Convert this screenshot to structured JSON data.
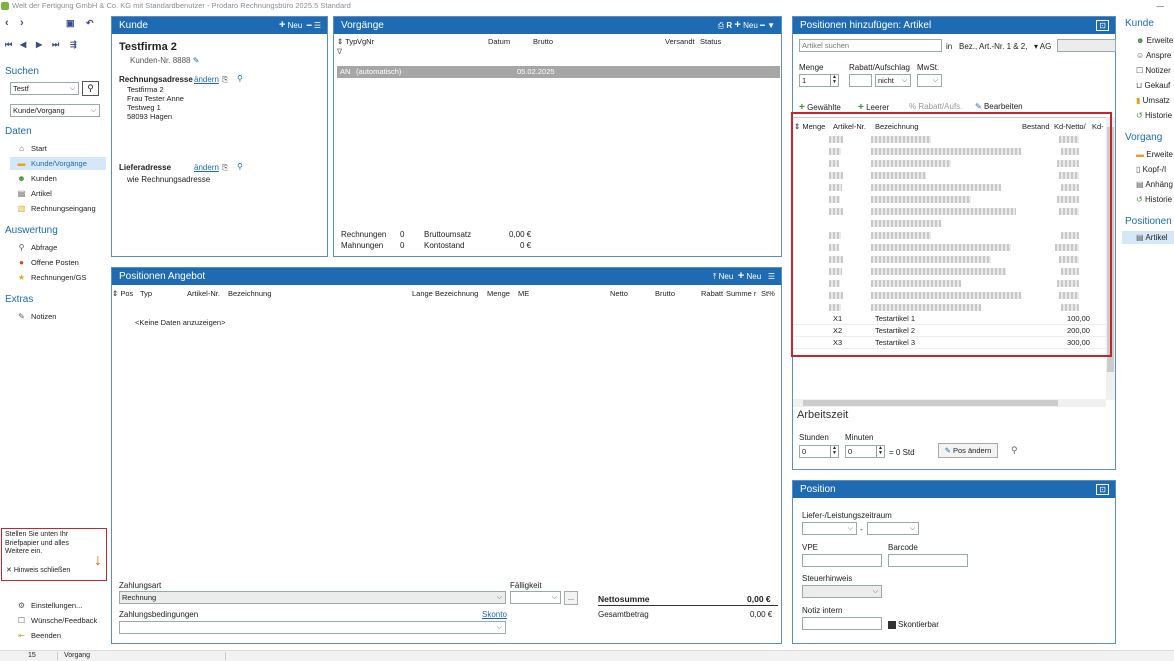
{
  "titlebar": {
    "title": "Welt der Fertigung GmbH & Co. KG mit Standardbenutzer - Prodaro Rechnungsbüro 2025.5 Standard",
    "min": "—"
  },
  "nav": {
    "search_section": "Suchen",
    "search_value": "Testf",
    "search_scope": "Kunde/Vorgang",
    "daten": "Daten",
    "daten_items": [
      "Start",
      "Kunde/Vorgänge",
      "Kunden",
      "Artikel",
      "Rechnungseingang"
    ],
    "auswertung": "Auswertung",
    "auswertung_items": [
      "Abfrage",
      "Offene Posten",
      "Rechnungen/GS"
    ],
    "extras": "Extras",
    "extras_items": [
      "Notizen"
    ],
    "bottom_items": [
      "Einstellungen...",
      "Wünsche/Feedback",
      "Beenden"
    ]
  },
  "hint": {
    "text": "Stellen Sie unten Ihr Briefpapier und alles Weitere ein.",
    "close": "Hinweis schließen"
  },
  "kunde": {
    "header": "Kunde",
    "neu": "Neu",
    "name": "Testfirma 2",
    "kundennr": "Kunden-Nr. 8888",
    "rechnungsadresse": "Rechnungsadresse",
    "aendern": "ändern",
    "address": [
      "Testfirma 2",
      "Frau Tester Anne",
      "Testweg 1",
      "58093 Hagen"
    ],
    "lieferadresse": "Lieferadresse",
    "liefer_value": "wie Rechnungsadresse"
  },
  "vorgaenge": {
    "header": "Vorgänge",
    "r": "R",
    "neu": "Neu",
    "cols": [
      "Typ",
      "VgNr",
      "Datum",
      "Brutto",
      "Versandt",
      "Status"
    ],
    "row": {
      "typ": "AN",
      "vgnr": "(automatisch)",
      "datum": "05.02.2025"
    },
    "summary": {
      "rechnungen": "Rechnungen",
      "rechnungen_val": "0",
      "mahnungen": "Mahnungen",
      "mahnungen_val": "0",
      "bruttoumsatz": "Bruttoumsatz",
      "bruttoumsatz_val": "0,00 €",
      "kontostand": "Kontostand",
      "kontostand_val": "0 €"
    }
  },
  "positionen_angebot": {
    "header": "Positionen Angebot",
    "neu1": "Neu",
    "neu2": "Neu",
    "cols": [
      "Pos",
      "Typ",
      "Artikel-Nr.",
      "Bezeichnung",
      "Lange Bezeichnung",
      "Menge",
      "ME",
      "Netto",
      "Brutto",
      "Rabatt",
      "Summe r",
      "St%"
    ],
    "empty": "<Keine Daten anzuzeigen>",
    "zahlungsart_label": "Zahlungsart",
    "zahlungsart_value": "Rechnung",
    "faelligkeit": "Fälligkeit",
    "zahlungsbedingungen": "Zahlungsbedingungen",
    "skonto": "Skonto",
    "nettosumme": "Nettosumme",
    "nettosumme_val": "0,00 €",
    "gesamtbetrag": "Gesamtbetrag",
    "gesamtbetrag_val": "0,00 €"
  },
  "artikel_panel": {
    "header": "Positionen hinzufügen: Artikel",
    "search_placeholder": "Artikel suchen",
    "in": "in",
    "scope": "Bez., Art.-Nr. 1 & 2,",
    "ag": "AG",
    "menge": "Menge",
    "rabatt": "Rabatt/Aufschlag",
    "mwst": "MwSt.",
    "menge_val": "1",
    "nicht": "nicht",
    "btn_gewaehlte": "Gewählte",
    "btn_leerer": "Leerer",
    "btn_rabatt": "Rabatt/Aufs.",
    "btn_bearbeiten": "Bearbeiten",
    "cols": [
      "Menge",
      "Artikel-Nr.",
      "Bezeichnung",
      "Bestand",
      "Kd-Netto/",
      "Kd-"
    ],
    "rows": [
      {
        "nr": "X1",
        "bez": "Testartikel 1",
        "netto": "100,00"
      },
      {
        "nr": "X2",
        "bez": "Testartikel 2",
        "netto": "200,00"
      },
      {
        "nr": "X3",
        "bez": "Testartikel 3",
        "netto": "300,00"
      }
    ],
    "arbeitszeit": "Arbeitszeit",
    "stunden": "Stunden",
    "minuten": "Minuten",
    "stunden_val": "0",
    "minuten_val": "0",
    "std": "= 0 Std",
    "pos_aendern": "Pos ändern"
  },
  "position_panel": {
    "header": "Position",
    "liefer": "Liefer-/Leistungszeitraum",
    "vpe": "VPE",
    "barcode": "Barcode",
    "steuerhinweis": "Steuerhinweis",
    "notiz": "Notiz intern",
    "skontierbar": "Skontierbar"
  },
  "right": {
    "kunde": "Kunde",
    "kunde_items": [
      "Erweite",
      "Anspre",
      "Notizer",
      "Gekauf",
      "Umsatz",
      "Historie"
    ],
    "vorgang": "Vorgang",
    "vorgang_items": [
      "Erweite",
      "Kopf-/I",
      "Anhäng",
      "Historie"
    ],
    "positionen": "Positionen h",
    "positionen_items": [
      "Artikel"
    ]
  },
  "status": {
    "count": "15",
    "label": "Vorgang"
  }
}
